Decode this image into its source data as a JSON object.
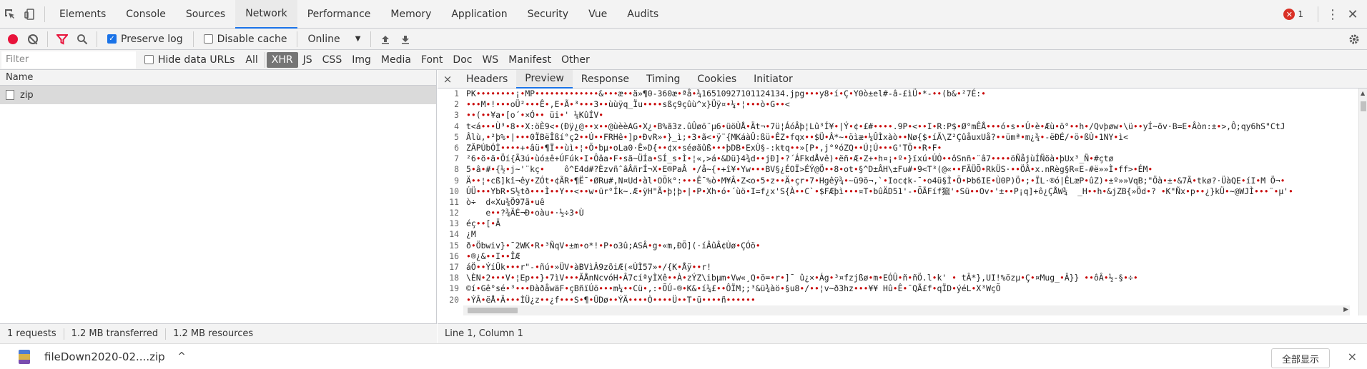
{
  "devtools": {
    "tabs": [
      "Elements",
      "Console",
      "Sources",
      "Network",
      "Performance",
      "Memory",
      "Application",
      "Security",
      "Vue",
      "Audits"
    ],
    "active_tab": "Network",
    "error_count": "1",
    "error_badge": "✕"
  },
  "toolbar": {
    "preserve_log": "Preserve log",
    "disable_cache": "Disable cache",
    "throttle": "Online"
  },
  "filterbar": {
    "placeholder": "Filter",
    "hide_data_urls": "Hide data URLs",
    "types": [
      "All",
      "XHR",
      "JS",
      "CSS",
      "Img",
      "Media",
      "Font",
      "Doc",
      "WS",
      "Manifest",
      "Other"
    ],
    "active_type": "XHR"
  },
  "request_list": {
    "header": "Name",
    "rows": [
      {
        "name": "zip"
      }
    ]
  },
  "status": {
    "requests": "1 requests",
    "transferred": "1.2 MB transferred",
    "resources": "1.2 MB resources"
  },
  "detail": {
    "close": "×",
    "tabs": [
      "Headers",
      "Preview",
      "Response",
      "Timing",
      "Cookies",
      "Initiator"
    ],
    "active_tab": "Preview",
    "lines": [
      "PK••••••••¡•MP•••••••••••••&•••æ••ä»¶0-360æ•ªå•¾16510927101124134.jpg•••y8•í•Ç•Y0ò±el#-â-£ìÜ•*-••(b&•²7É:•",
      "•••M•!•••oÜ²•••Ê•,E•Ã•³•••3••ùùÿq_Ïu••••sßç9çûù^x}Üÿ¤•¼•¦•••ò•G••<",
      "••(••¥a•[o´•×Ó•• üi•' ¼KûÍV•",
      "t<á•••Ù³•8••X:öÈ9<•(Ðÿ¿@••x••@ùèèAG•X¿•B%ã3z.ûÛøö¨µ6•üöÙÅ•Ät¬•7ü¦ÁóÂþ¦Lû³Í¥•|Ý•¢•£#••••.9P•<••I•R:P$•Ø°mÊÅ•••ó•s••Ú•è•Æù•ö°••h•/Qvþøw•\\ü••yÍ~õv·B=E•Âòn:±•>,Ô;qy6hS\"CtJ",
      "Âlù,•²þ%•|•••0ÏBëÎßí°ç2••Ú••FRHê•]p•ÐvR»•}_ì;•3•ã<•ÿ¨{MKáàÛ:ßü•ÊZ•fqx••$Ü•Â*~•öìæ•¼ÛÌxàò••Nø{$•íÃ\\Z²ÇûåuxUå?••ümª•m¿¾•-ëÐÉ/•ö•ßÙ•1NY•ì<",
      "ZÃPÚbÓÌ••••+•âü•¶Ï••ùì•¦•Õ•bµ•oLa0·Ê»D{••¢x•séøãûß•••þDB•ExÙ§-:kŧq••»[P•,j°ºóZQ••Ú¦Ú•••G'TÕ••R•F•",
      "²6•õ•ä•Öí{Ã3ú•ùó±ê+ÚFúk•I•Ôâa•F•sã~ÜÍa•SÍ_s•Ì•¦«,>á•&Dü}4¾d••jÐ]•?´ÁFkdÅvê)•ëñ•Æ•Z+•h¤¡•º•}ïxú•ÚÓ••ôSnñ•¨â7••••öÑåjùÍÑõà•þUx³_Ñ•#çtø",
      "5•â•#•{½•j~'¨kç•    ô^E4d#?ÈzvñˆâÂñrÍ¬X•E®PaÂ •/å~{•+î¥•Yw•••BV§¿ÉOÏ>ÉÝ@Ö••8•ot•§^D±ÂH\\±Fu#•9<T³(@«••FÄÜÕ•RkÜS·••ÖÂ•x.nRèg§R«E-#ë»»Ì•ff>•ÉM•",
      "Ä••¦•cß]kî¬êy•ZÓt•¢ÃR•¶Ë¯•ØRu#,N¤Ud•àl•OÕk°:•••Ê¯%ò•M¥Â•Z<o•5•z••Ä•çr•7•Hgêÿ¾•~ü9ö¬,`•Ioc¢k-¯•o4ü§Ì•Õ•Þb6IE•Ù0P)Ö•;•ÏL·®ó|ÊLæP•ûZ)•±º»»VqB;\"Öà•±•&7Ã•tkø?·ÜàQE•íI•M Ö¬•",
      "ÚÜ•••YbR•S½tð•••Ì••Y••<••w•ür°Ík~.Æ•ÿH\"Ã•þ¦þ•|•P•Xh•ó•´ùö•I=f¿x'S{À••C`•$FÆþì•••¤T•bûÄD51'-•ÕÃFíf㺠'•Sü••Ov•'±••P¡q]+ô¿ÇÅW¾  _H••h•&jZB{»Öd•? •K\"Ñx•p••¿}kÜ•~@WJÌ•••¨•µ'•",
      "ò÷  d«Xu¾Ö97ã•uê",
      "    e••?¾ÄÉ¬Ð•oàu•·½÷3•Ù",
      "éç••[•Ä",
      "¿M",
      "ð•Öbwiv}•¯2WK•R•³ÑqV•±m•o*!•P•o3û;ASÂ•g•«m,ÐÕ](·íÂûÂ¢Ùø•ÇÓö•",
      "•®¿&••I••ÎÆ",
      "áÖ••ÝíÜk•••r\"-•ñú•»ÜV•àBVìÂ9zõiÆ(«ÙÌ57»•/{K•Åÿ••r!",
      "\\ÈN•2•••V•¦Ep••}•7ìV•••ÃÅnNcvóH•Â7cíªyÌXê••À•zÝZ\\ibµm•Vw«¸Q•ö=•r•]¯ û¿×•Ág•³¤fzjßø•m•EÓÛ•ñ•ñÖ.l•k' • tÂ*},UI!%özµ•Ç•¤Mug_•Â}} ••ôÂ•½-§•÷•",
      "©í•Gê°sé•³•••ÐàðåwäF•çBñïÚö•••m¼••Cü•,:•ÕÚ-®•K&•í¼£••ÔÏM;;³&ü¾àö•§u8•/••¦v~ð3hz•••¥¥ Hû•Ê•¯QÃ£f•qÏD•ýéL•X³WçÕ",
      "•ÝÂ•ëÅ•Ä•••ÌÜ¿z••¿f•••S•¶•ÜDø••ÝÄ••••Ò••••Ü••T•ü••••ñ••••••"
    ],
    "cursor": "Line 1, Column 1"
  },
  "download": {
    "filename": "fileDown2020-02....zip",
    "chevron": "^",
    "show_all": "全部显示",
    "close": "×"
  }
}
